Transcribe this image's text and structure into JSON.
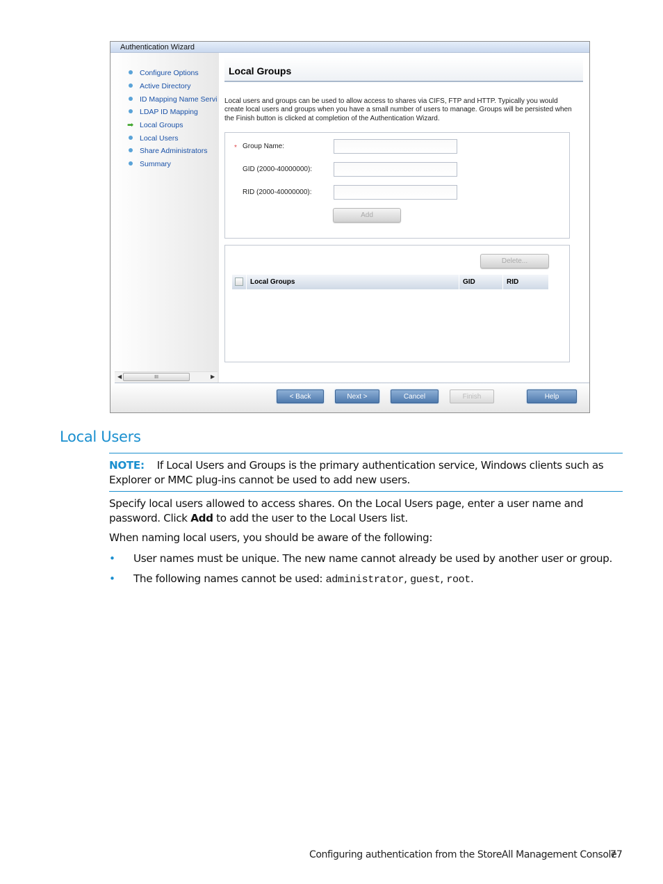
{
  "wizard": {
    "title": "Authentication Wizard",
    "nav": [
      {
        "label": "Configure Options",
        "current": false
      },
      {
        "label": "Active Directory",
        "current": false
      },
      {
        "label": "ID Mapping Name Servi",
        "current": false
      },
      {
        "label": "LDAP ID Mapping",
        "current": false
      },
      {
        "label": "Local Groups",
        "current": true
      },
      {
        "label": "Local Users",
        "current": false
      },
      {
        "label": "Share Administrators",
        "current": false
      },
      {
        "label": "Summary",
        "current": false
      }
    ],
    "scroll_thumb_glyph": "III",
    "page_title": "Local Groups",
    "description": "Local users and groups can be used to allow access to shares via CIFS, FTP and HTTP. Typically you would create local users and groups when you have a small number of users to manage. Groups will be persisted when the Finish button is clicked at completion of the Authentication Wizard.",
    "form": {
      "required_mark": "*",
      "group_name_label": "Group Name:",
      "group_name_value": "",
      "gid_label": "GID (2000-40000000):",
      "gid_value": "",
      "rid_label": "RID (2000-40000000):",
      "rid_value": "",
      "add_button": "Add"
    },
    "list": {
      "delete_button": "Delete...",
      "columns": [
        "Local Groups",
        "GID",
        "RID"
      ],
      "rows": []
    },
    "buttons": {
      "back": "< Back",
      "next": "Next >",
      "cancel": "Cancel",
      "finish": "Finish",
      "help": "Help"
    }
  },
  "doc": {
    "section_title": "Local Users",
    "note_label": "NOTE:",
    "note_text": "If Local Users and Groups is the primary authentication service, Windows clients such as Explorer or MMC plug-ins cannot be used to add new users.",
    "para1_a": "Specify local users allowed to access shares. On the Local Users page, enter a user name and password. Click ",
    "para1_bold": "Add",
    "para1_b": " to add the user to the Local Users list.",
    "para2": "When naming local users, you should be aware of the following:",
    "bullet_glyph": "•",
    "bullet1": "User names must be unique. The new name cannot already be used by another user or group.",
    "bullet2_prefix": "The following names cannot be used: ",
    "bullet2_codes": [
      "administrator",
      "guest",
      "root"
    ],
    "bullet2_sep": ", ",
    "bullet2_end": "."
  },
  "footer": {
    "text": "Configuring authentication from the StoreAll Management Console",
    "page_number": "77"
  }
}
